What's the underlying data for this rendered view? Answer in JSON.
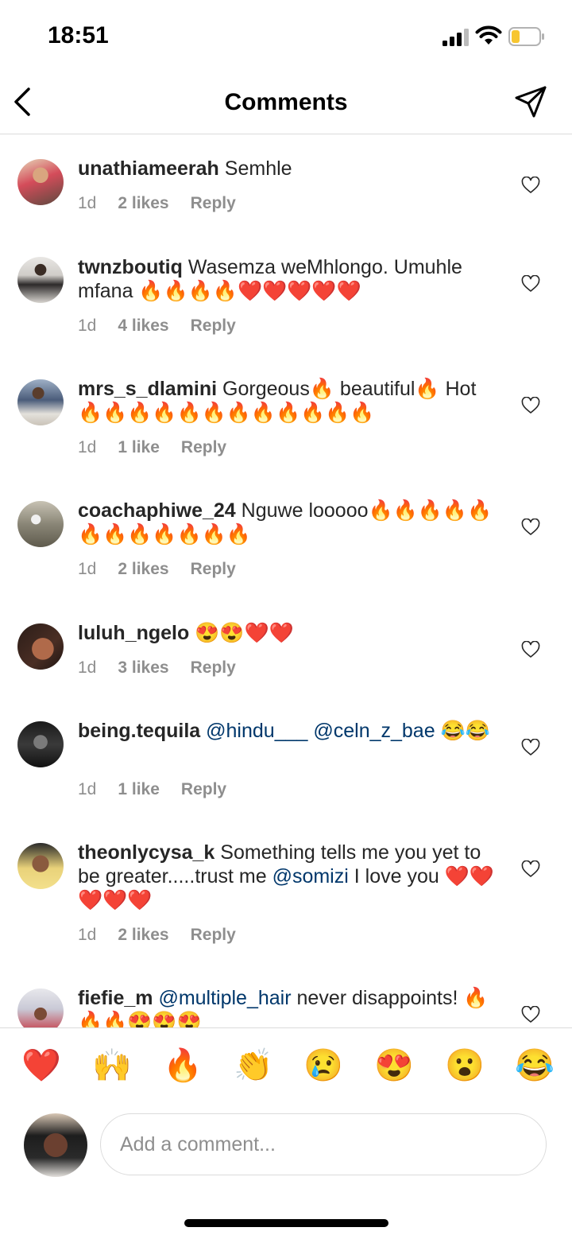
{
  "status": {
    "time": "18:51"
  },
  "header": {
    "title": "Comments"
  },
  "comments": [
    {
      "username": "unathiameerah",
      "text": "Semhle",
      "time": "1d",
      "likes": "2 likes",
      "reply": "Reply"
    },
    {
      "username": "twnzboutiq",
      "text": "Wasemza weMhlongo. Umuhle mfana 🔥🔥🔥🔥❤️❤️❤️❤️❤️",
      "time": "1d",
      "likes": "4 likes",
      "reply": "Reply"
    },
    {
      "username": "mrs_s_dlamini",
      "text": "Gorgeous🔥 beautiful🔥 Hot🔥🔥🔥🔥🔥🔥🔥🔥🔥🔥🔥🔥",
      "time": "1d",
      "likes": "1 like",
      "reply": "Reply"
    },
    {
      "username": "coachaphiwe_24",
      "text": "Nguwe looooo🔥🔥🔥🔥🔥🔥🔥🔥🔥🔥🔥🔥",
      "time": "1d",
      "likes": "2 likes",
      "reply": "Reply"
    },
    {
      "username": "luluh_ngelo",
      "text": "😍😍❤️❤️",
      "time": "1d",
      "likes": "3 likes",
      "reply": "Reply"
    },
    {
      "username": "being.tequila",
      "mention1": "@hindu___",
      "mention2": "@celn_z_bae",
      "text": "😂😂",
      "time": "1d",
      "likes": "1 like",
      "reply": "Reply"
    },
    {
      "username": "theonlycysa_k",
      "text_before": "Something tells me you yet to be greater.....trust me",
      "mention": "@somizi",
      "text_after": "I love you ❤️❤️❤️❤️❤️",
      "time": "1d",
      "likes": "2 likes",
      "reply": "Reply"
    },
    {
      "username": "fiefie_m",
      "mention": "@multiple_hair",
      "text": "never disappoints! 🔥🔥🔥😍😍😍"
    }
  ],
  "quick_emojis": [
    "❤️",
    "🙌",
    "🔥",
    "👏",
    "😢",
    "😍",
    "😮",
    "😂"
  ],
  "composer": {
    "placeholder": "Add a comment..."
  },
  "colors": {
    "mention": "#00376b",
    "meta": "#8e8e8e",
    "divider": "#dbdbdb"
  }
}
